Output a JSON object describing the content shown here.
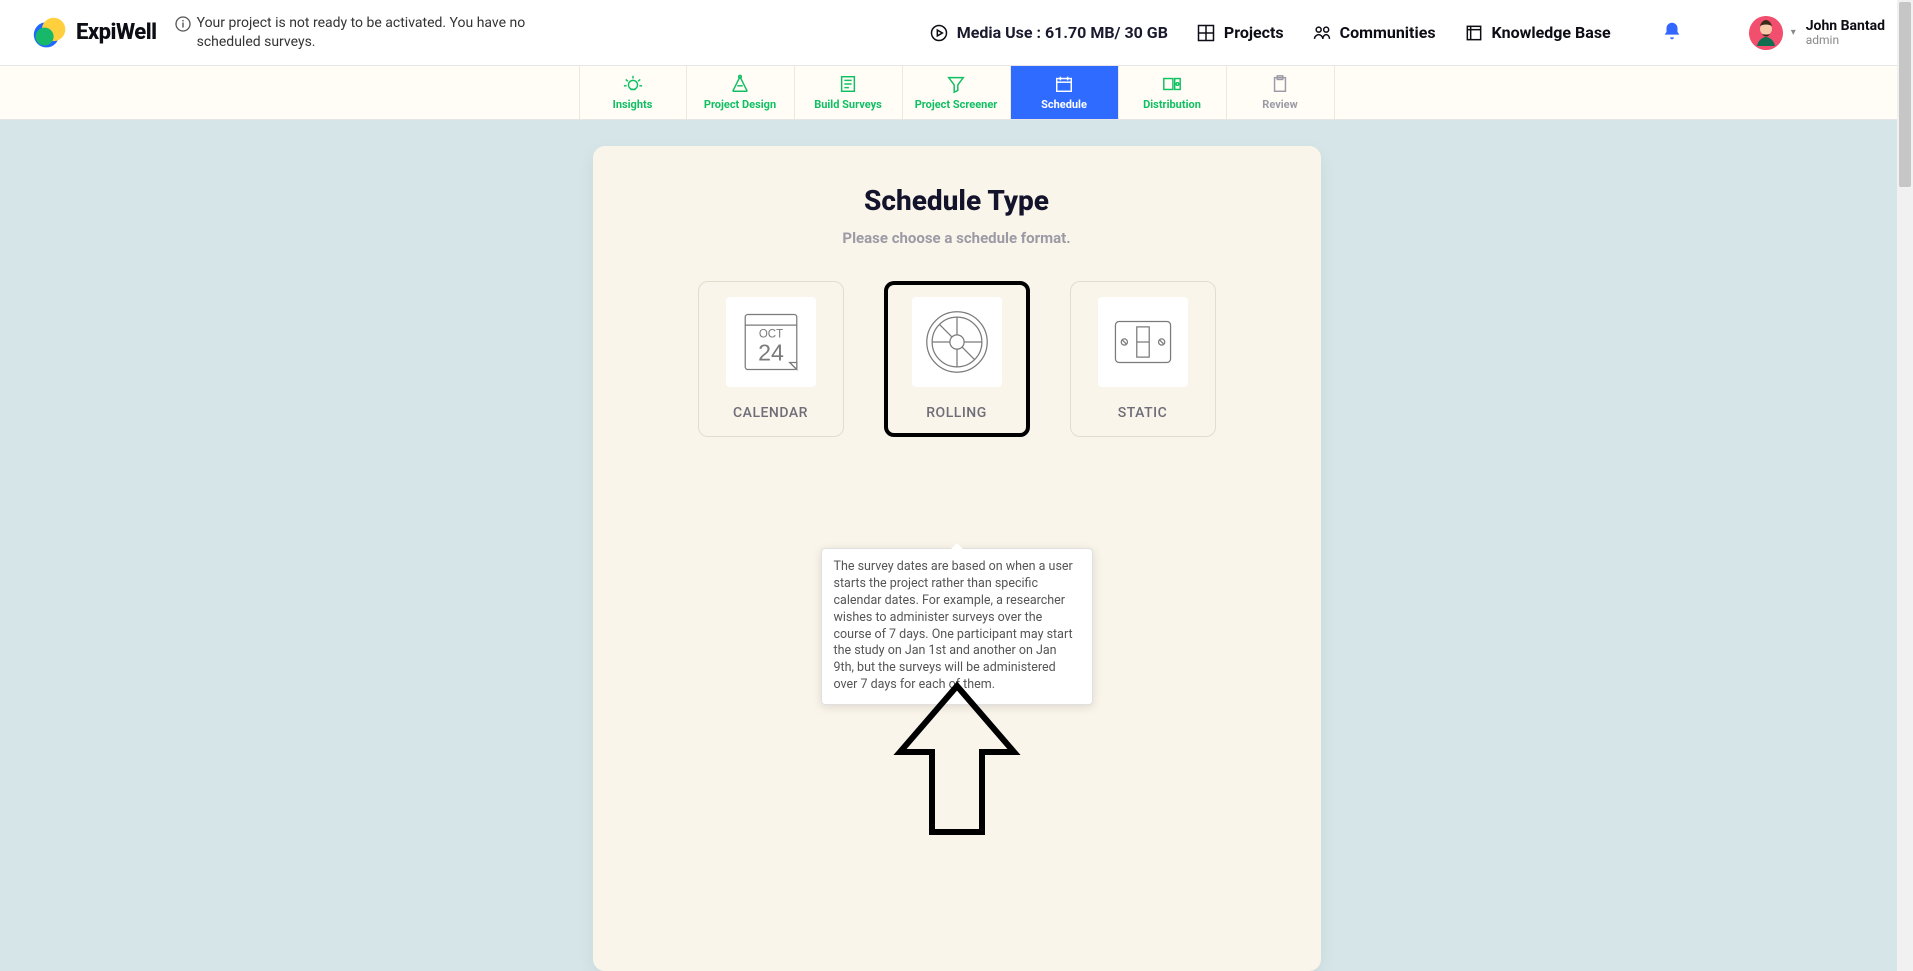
{
  "brand": "ExpiWell",
  "warning": "Your project is not ready to be activated. You have no scheduled surveys.",
  "media_use": "Media Use : 61.70 MB/ 30 GB",
  "header_links": {
    "projects": "Projects",
    "communities": "Communities",
    "knowledge_base": "Knowledge Base"
  },
  "user": {
    "name": "John Bantad",
    "role": "admin"
  },
  "tabs": {
    "insights": "Insights",
    "project_design": "Project Design",
    "build_surveys": "Build Surveys",
    "project_screener": "Project Screener",
    "schedule": "Schedule",
    "distribution": "Distribution",
    "review": "Review"
  },
  "card": {
    "title": "Schedule Type",
    "subtitle": "Please choose a schedule format.",
    "options": {
      "calendar": "CALENDAR",
      "rolling": "ROLLING",
      "static": "STATIC"
    },
    "calendar_month": "OCT",
    "calendar_day": "24",
    "selected": "rolling"
  },
  "tooltip": "The survey dates are based on when a user starts the project rather than specific calendar dates. For example, a researcher wishes to administer surveys over the course of 7 days. One participant may start the study on Jan 1st and another on Jan 9th, but the surveys will be administered over 7 days for each of them."
}
